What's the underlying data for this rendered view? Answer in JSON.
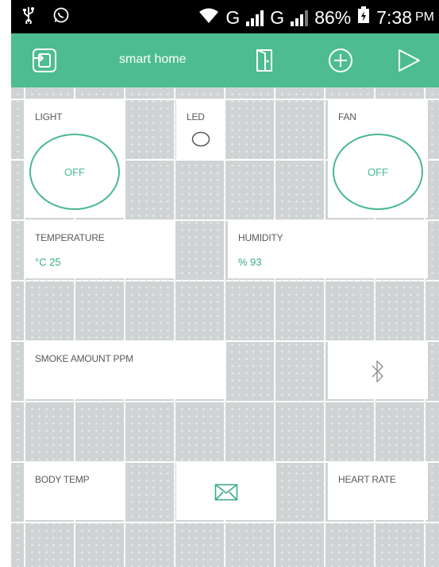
{
  "status_bar": {
    "network": "G",
    "network2": "G",
    "battery": "86%",
    "time": "7:38",
    "ampm": "PM"
  },
  "app_bar": {
    "title": "smart home",
    "icons": [
      "device-icon",
      "panel-icon",
      "add-icon",
      "play-icon"
    ]
  },
  "widgets": {
    "light": {
      "label": "LIGHT",
      "button": "OFF"
    },
    "led": {
      "label": "LED"
    },
    "fan": {
      "label": "FAN",
      "button": "OFF"
    },
    "temperature": {
      "label": "TEMPERATURE",
      "value": "°C 25"
    },
    "humidity": {
      "label": "HUMIDITY",
      "value": "% 93"
    },
    "smoke": {
      "label": "SMOKE AMOUNT PPM"
    },
    "bluetooth": {
      "icon": "bluetooth-icon"
    },
    "body_temp": {
      "label": "BODY TEMP"
    },
    "email": {
      "icon": "mail-icon"
    },
    "heart_rate": {
      "label": "HEART RATE"
    }
  },
  "colors": {
    "accent": "#4dbd8f",
    "value_text": "#3daa85",
    "canvas": "#cfd3d4"
  }
}
